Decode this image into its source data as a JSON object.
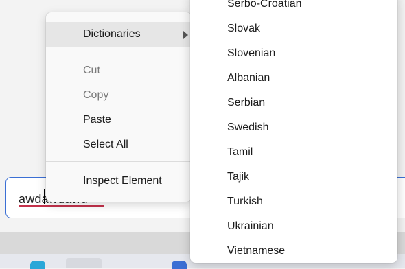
{
  "input": {
    "value": "awdawdawd"
  },
  "context_menu": {
    "items": [
      {
        "label": "Dictionaries",
        "has_submenu": true
      },
      {
        "label": "Cut",
        "disabled": true
      },
      {
        "label": "Copy",
        "disabled": true
      },
      {
        "label": "Paste"
      },
      {
        "label": "Select All"
      },
      {
        "label": "Inspect Element"
      }
    ]
  },
  "submenu": {
    "items": [
      {
        "label": "Serbo-Croatian"
      },
      {
        "label": "Slovak"
      },
      {
        "label": "Slovenian"
      },
      {
        "label": "Albanian"
      },
      {
        "label": "Serbian"
      },
      {
        "label": "Swedish"
      },
      {
        "label": "Tamil"
      },
      {
        "label": "Tajik"
      },
      {
        "label": "Turkish"
      },
      {
        "label": "Ukrainian"
      },
      {
        "label": "Vietnamese"
      }
    ]
  },
  "colors": {
    "accent": "#3b6fd4",
    "spellcheck": "#c4314b"
  }
}
